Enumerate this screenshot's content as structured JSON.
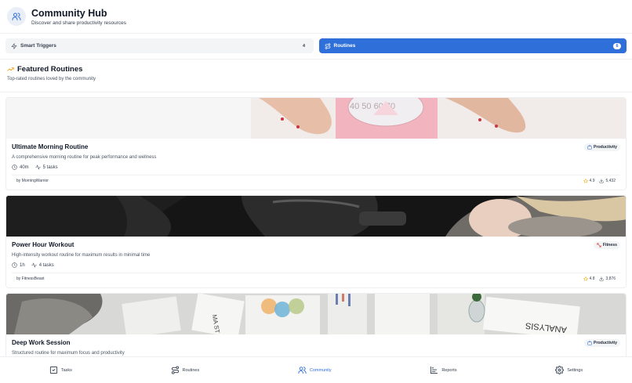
{
  "header": {
    "title": "Community Hub",
    "subtitle": "Discover and share productivity resources",
    "icon": "users-icon"
  },
  "tabs": [
    {
      "label": "Smart Triggers",
      "count": "4",
      "icon": "zap-icon",
      "active": false
    },
    {
      "label": "Routines",
      "count": "6",
      "icon": "route-icon",
      "active": true
    }
  ],
  "section": {
    "title": "Featured Routines",
    "subtitle": "Top-rated routines loved by the community",
    "icon": "trending-up-icon"
  },
  "routines": [
    {
      "title": "Ultimate Morning Routine",
      "description": "A comprehensive morning routine for peak performance and wellness",
      "duration": "40m",
      "tasks": "5 tasks",
      "author": "by MorningWarrior",
      "category": "Productivity",
      "rating": "4.9",
      "downloads": "5,432",
      "image": "feet-on-scale-photo"
    },
    {
      "title": "Power Hour Workout",
      "description": "High-intensity workout routine for maximum results in minimal time",
      "duration": "1h",
      "tasks": "4 tasks",
      "author": "by FitnessBeast",
      "category": "Fitness",
      "rating": "4.8",
      "downloads": "3,876",
      "image": "workout-photo"
    },
    {
      "title": "Deep Work Session",
      "description": "Structured routine for maximum focus and productivity",
      "category": "Productivity",
      "image": "desk-analysis-photo"
    }
  ],
  "nav": [
    {
      "label": "Tasks",
      "icon": "checkbox-icon",
      "active": false
    },
    {
      "label": "Routines",
      "icon": "route-icon",
      "active": false
    },
    {
      "label": "Community",
      "icon": "users-icon",
      "active": true
    },
    {
      "label": "Reports",
      "icon": "chart-icon",
      "active": false
    },
    {
      "label": "Settings",
      "icon": "settings-icon",
      "active": false
    }
  ],
  "colors": {
    "accent": "#2f6fd9",
    "star": "#f2b01e",
    "fitness_badge": "#e0453a",
    "trend": "#f59e0b"
  }
}
